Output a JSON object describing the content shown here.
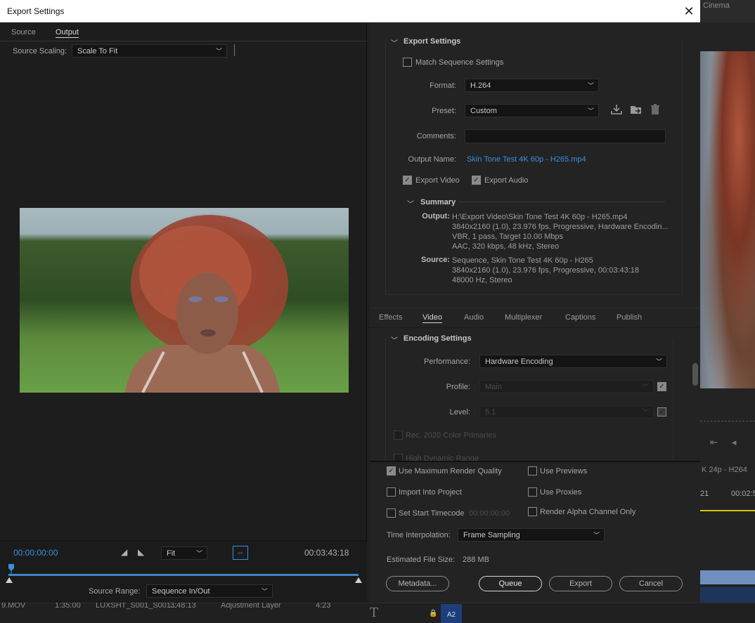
{
  "background": {
    "workspace_tab": "Cinema",
    "sequence_label": "K 24p - H264",
    "timeline_ruler": [
      "21",
      "00:02:5"
    ],
    "bottom_row": {
      "clip_file": "9.MOV",
      "time1": "1:35:00",
      "clip_name": "LUXSHT_S001_S001...",
      "time2": "3:48:13",
      "layer": "Adjustment Layer",
      "time3": "4:23",
      "track": "A2"
    }
  },
  "dialog": {
    "title": "Export Settings",
    "close_glyph": "✕"
  },
  "left": {
    "tabs": [
      "Source",
      "Output"
    ],
    "active_tab": "Output",
    "source_scaling_label": "Source Scaling:",
    "source_scaling_value": "Scale To Fit",
    "current_timecode": "00:00:00:00",
    "total_timecode": "00:03:43:18",
    "zoom_value": "Fit",
    "source_range_label": "Source Range:",
    "source_range_value": "Sequence In/Out"
  },
  "export_settings": {
    "section_title": "Export Settings",
    "match_sequence_label": "Match Sequence Settings",
    "match_sequence_checked": false,
    "format_label": "Format:",
    "format_value": "H.264",
    "preset_label": "Preset:",
    "preset_value": "Custom",
    "comments_label": "Comments:",
    "comments_value": "",
    "output_name_label": "Output Name:",
    "output_name_value": "Skin Tone Test 4K 60p  - H265.mp4",
    "export_video_label": "Export Video",
    "export_video_checked": true,
    "export_audio_label": "Export Audio",
    "export_audio_checked": true,
    "summary": {
      "title": "Summary",
      "output_label": "Output:",
      "output_lines": [
        "H:\\Export Video\\Skin Tone Test 4K 60p  - H265.mp4",
        "3840x2160 (1.0), 23.976 fps, Progressive, Hardware Encodin...",
        "VBR, 1 pass, Target 10.00 Mbps",
        "AAC, 320 kbps, 48 kHz, Stereo"
      ],
      "source_label": "Source:",
      "source_lines": [
        "Sequence, Skin Tone Test 4K 60p  - H265",
        "3840x2160 (1.0), 23.976 fps, Progressive, 00:03:43:18",
        "48000 Hz, Stereo"
      ]
    }
  },
  "settings_tabs": [
    "Effects",
    "Video",
    "Audio",
    "Multiplexer",
    "Captions",
    "Publish"
  ],
  "active_settings_tab": "Video",
  "encoding": {
    "section_title": "Encoding Settings",
    "performance_label": "Performance:",
    "performance_value": "Hardware Encoding",
    "profile_label": "Profile:",
    "profile_value": "Main",
    "level_label": "Level:",
    "level_value": "5.1",
    "rec2020_label": "Rec. 2020 Color Primaries",
    "hdr_label": "High Dynamic Range"
  },
  "bottom": {
    "use_max_render_quality": "Use Maximum Render Quality",
    "use_previews": "Use Previews",
    "import_into_project": "Import Into Project",
    "use_proxies": "Use Proxies",
    "set_start_timecode": "Set Start Timecode",
    "start_timecode_value": "00:00:00:00",
    "render_alpha_only": "Render Alpha Channel Only",
    "time_interpolation_label": "Time Interpolation:",
    "time_interpolation_value": "Frame Sampling",
    "estimated_size_label": "Estimated File Size:",
    "estimated_size_value": "288 MB",
    "buttons": {
      "metadata": "Metadata...",
      "queue": "Queue",
      "export": "Export",
      "cancel": "Cancel"
    }
  },
  "colors": {
    "accent_blue": "#3a8fdc",
    "panel": "#232323",
    "title_bar": "#ffffff"
  }
}
